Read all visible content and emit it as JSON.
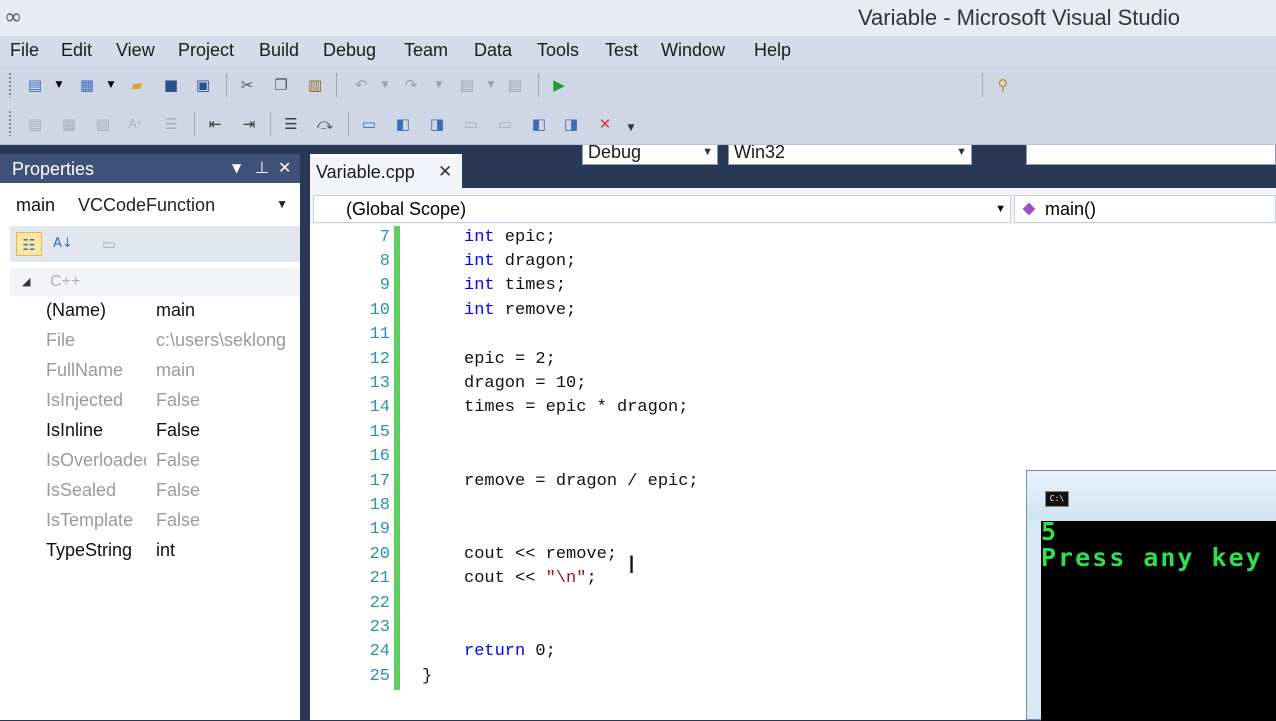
{
  "window": {
    "title": "Variable - Microsoft Visual Studio",
    "logo_icon": "infinity-logo-icon"
  },
  "menu": [
    "File",
    "Edit",
    "View",
    "Project",
    "Build",
    "Debug",
    "Team",
    "Data",
    "Tools",
    "Test",
    "Window",
    "Help"
  ],
  "toolbar": {
    "config": "Debug",
    "platform": "Win32"
  },
  "properties": {
    "title": "Properties",
    "object_name": "main",
    "object_type": "VCCodeFunction",
    "category": "C++",
    "rows": [
      {
        "name": "(Name)",
        "value": "main"
      },
      {
        "name": "File",
        "value": "c:\\users\\seklong"
      },
      {
        "name": "FullName",
        "value": "main"
      },
      {
        "name": "IsInjected",
        "value": "False"
      },
      {
        "name": "IsInline",
        "value": "False"
      },
      {
        "name": "IsOverloaded",
        "value": "False"
      },
      {
        "name": "IsSealed",
        "value": "False"
      },
      {
        "name": "IsTemplate",
        "value": "False"
      },
      {
        "name": "TypeString",
        "value": "int"
      }
    ]
  },
  "editor": {
    "tab": "Variable.cpp",
    "scope": "(Global Scope)",
    "function": "main()",
    "lines": [
      {
        "n": "7",
        "kw": "int",
        "text": " epic;"
      },
      {
        "n": "8",
        "kw": "int",
        "text": " dragon;"
      },
      {
        "n": "9",
        "kw": "int",
        "text": " times;"
      },
      {
        "n": "10",
        "kw": "int",
        "text": " remove;"
      },
      {
        "n": "11",
        "kw": "",
        "text": ""
      },
      {
        "n": "12",
        "kw": "",
        "text": "epic = 2;"
      },
      {
        "n": "13",
        "kw": "",
        "text": "dragon = 10;"
      },
      {
        "n": "14",
        "kw": "",
        "text": "times = epic * dragon;"
      },
      {
        "n": "15",
        "kw": "",
        "text": ""
      },
      {
        "n": "16",
        "kw": "",
        "text": ""
      },
      {
        "n": "17",
        "kw": "",
        "text": "remove = dragon / epic;"
      },
      {
        "n": "18",
        "kw": "",
        "text": ""
      },
      {
        "n": "19",
        "kw": "",
        "text": ""
      },
      {
        "n": "20",
        "kw": "",
        "text": "cout << remove;"
      },
      {
        "n": "21",
        "kw": "",
        "text": "cout << ",
        "str": "\"\\n\"",
        "after": ";"
      },
      {
        "n": "22",
        "kw": "",
        "text": ""
      },
      {
        "n": "23",
        "kw": "",
        "text": ""
      },
      {
        "n": "24",
        "kw": "return",
        "text": " 0;"
      },
      {
        "n": "25",
        "kw": "",
        "text": "}"
      }
    ]
  },
  "console": {
    "icon": "C:\\",
    "lines": [
      "5",
      "Press any key"
    ]
  }
}
